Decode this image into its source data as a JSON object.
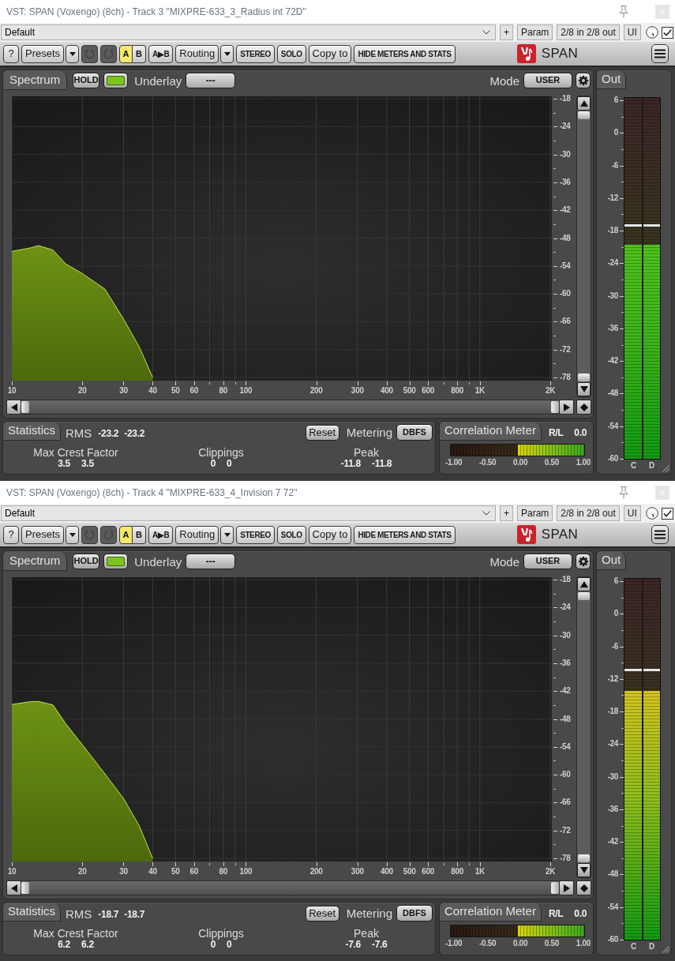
{
  "windows": [
    {
      "title": "VST: SPAN (Voxengo) (8ch) - Track 3 \"MIXPRE-633_3_Radius int 72D\"",
      "preset_bar": {
        "preset": "Default",
        "buttons": [
          "+",
          "Param",
          "2/8 in 2/8 out",
          "UI"
        ],
        "checkbox": {
          "checked": true
        }
      },
      "toolbar": {
        "items": [
          {
            "kind": "button",
            "label": "?"
          },
          {
            "kind": "button",
            "label": "Presets"
          },
          {
            "kind": "caret"
          },
          {
            "kind": "undo",
            "disabled": true
          },
          {
            "kind": "redo",
            "disabled": true
          },
          {
            "kind": "ab",
            "label": "A",
            "selected": true
          },
          {
            "kind": "ab",
            "label": "B",
            "selected": false
          },
          {
            "kind": "caps",
            "label": "A▶B"
          },
          {
            "kind": "button",
            "label": "Routing"
          },
          {
            "kind": "caret"
          },
          {
            "kind": "caps",
            "label": "STEREO"
          },
          {
            "kind": "caps",
            "label": "SOLO"
          },
          {
            "kind": "button",
            "label": "Copy to"
          },
          {
            "kind": "caps",
            "label": "HIDE METERS AND STATS"
          }
        ],
        "product": "SPAN"
      },
      "spectrum": {
        "tab": "Spectrum",
        "hold": "HOLD",
        "underlay_label": "Underlay",
        "underlay": "---",
        "mode_label": "Mode",
        "mode": "USER",
        "level_labels": [
          "-18",
          "-24",
          "-30",
          "-36",
          "-42",
          "-48",
          "-54",
          "-60",
          "-66",
          "-72",
          "-78"
        ],
        "frequency_labels": [
          "10",
          "20",
          "30",
          "40",
          "50",
          "60",
          "80",
          "100",
          "200",
          "300",
          "400",
          "500",
          "600",
          "800",
          "1K",
          "2K"
        ]
      },
      "statistics": {
        "tab": "Statistics",
        "rms_label": "RMS",
        "rms": [
          "-23.2",
          "-23.2"
        ],
        "reset": "Reset",
        "metering_label": "Metering",
        "metering": "DBFS",
        "groups": [
          {
            "label": "Max Crest Factor",
            "values": [
              "3.5",
              "3.5"
            ]
          },
          {
            "label": "Clippings",
            "values": [
              "0",
              "0"
            ]
          },
          {
            "label": "Peak",
            "values": [
              "-11.8",
              "-11.8"
            ]
          }
        ]
      },
      "correlation": {
        "tab": "Correlation Meter",
        "channel": "R/L",
        "value": "0.0",
        "bar": {
          "level": 0.5
        },
        "scale": [
          "-1.00",
          "-0.50",
          "0.00",
          "0.50",
          "1.00"
        ]
      },
      "out": {
        "tab": "Out",
        "scale": [
          "6",
          "0",
          "-6",
          "-12",
          "-18",
          "-24",
          "-30",
          "-36",
          "-42",
          "-48",
          "-54",
          "-60"
        ],
        "channels": [
          {
            "label": "C",
            "level": 0.593,
            "hold": {
              "level": 0.645
            }
          },
          {
            "label": "D",
            "level": 0.593,
            "hold": {
              "level": 0.645
            }
          }
        ]
      }
    },
    {
      "title": "VST: SPAN (Voxengo) (8ch) - Track 4 \"MIXPRE-633_4_Invision 7 72\"",
      "preset_bar": {
        "preset": "Default",
        "buttons": [
          "+",
          "Param",
          "2/8 in 2/8 out",
          "UI"
        ],
        "checkbox": {
          "checked": true
        }
      },
      "toolbar": {
        "items": [
          {
            "kind": "button",
            "label": "?"
          },
          {
            "kind": "button",
            "label": "Presets"
          },
          {
            "kind": "caret"
          },
          {
            "kind": "undo",
            "disabled": true
          },
          {
            "kind": "redo",
            "disabled": true
          },
          {
            "kind": "ab",
            "label": "A",
            "selected": true
          },
          {
            "kind": "ab",
            "label": "B",
            "selected": false
          },
          {
            "kind": "caps",
            "label": "A▶B"
          },
          {
            "kind": "button",
            "label": "Routing"
          },
          {
            "kind": "caret"
          },
          {
            "kind": "caps",
            "label": "STEREO"
          },
          {
            "kind": "caps",
            "label": "SOLO"
          },
          {
            "kind": "button",
            "label": "Copy to"
          },
          {
            "kind": "caps",
            "label": "HIDE METERS AND STATS"
          }
        ],
        "product": "SPAN"
      },
      "spectrum": {
        "tab": "Spectrum",
        "hold": "HOLD",
        "underlay_label": "Underlay",
        "underlay": "---",
        "mode_label": "Mode",
        "mode": "USER",
        "level_labels": [
          "-18",
          "-24",
          "-30",
          "-36",
          "-42",
          "-48",
          "-54",
          "-60",
          "-66",
          "-72",
          "-78"
        ],
        "frequency_labels": [
          "10",
          "20",
          "30",
          "40",
          "50",
          "60",
          "80",
          "100",
          "200",
          "300",
          "400",
          "500",
          "600",
          "800",
          "1K",
          "2K"
        ]
      },
      "statistics": {
        "tab": "Statistics",
        "rms_label": "RMS",
        "rms": [
          "-18.7",
          "-18.7"
        ],
        "reset": "Reset",
        "metering_label": "Metering",
        "metering": "DBFS",
        "groups": [
          {
            "label": "Max Crest Factor",
            "values": [
              "6.2",
              "6.2"
            ]
          },
          {
            "label": "Clippings",
            "values": [
              "0",
              "0"
            ]
          },
          {
            "label": "Peak",
            "values": [
              "-7.6",
              "-7.6"
            ]
          }
        ]
      },
      "correlation": {
        "tab": "Correlation Meter",
        "channel": "R/L",
        "value": "0.0",
        "bar": {
          "level": 0.5
        },
        "scale": [
          "-1.00",
          "-0.50",
          "0.00",
          "0.50",
          "1.00"
        ]
      },
      "out": {
        "tab": "Out",
        "scale": [
          "6",
          "0",
          "-6",
          "-12",
          "-18",
          "-24",
          "-30",
          "-36",
          "-42",
          "-48",
          "-54",
          "-60"
        ],
        "channels": [
          {
            "label": "C",
            "level": 0.69,
            "hold": {
              "level": 0.747
            }
          },
          {
            "label": "D",
            "level": 0.69,
            "hold": {
              "level": 0.747
            }
          }
        ]
      }
    }
  ]
}
